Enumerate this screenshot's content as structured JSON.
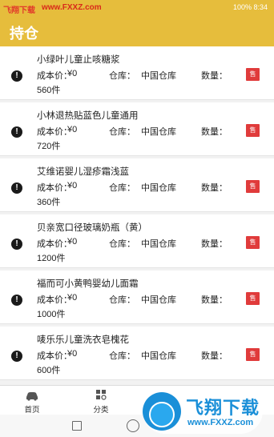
{
  "status_bar": {
    "left_watermark_a": "飞翔下载",
    "left_watermark_b": "www.FXXZ.com",
    "right_text": "100% 8:34"
  },
  "header": {
    "title": "持仓"
  },
  "labels": {
    "cost": "成本价：",
    "warehouse": "仓库：",
    "quantity": "数量：",
    "sell": "售"
  },
  "items": [
    {
      "name": "小绿叶儿童止咳糖浆",
      "cost": "¥0",
      "warehouse": "中国仓库",
      "qty": "560件"
    },
    {
      "name": "小林退热贴蓝色儿童通用",
      "cost": "¥0",
      "warehouse": "中国仓库",
      "qty": "720件"
    },
    {
      "name": "艾维诺婴儿湿疹霜浅蓝",
      "cost": "¥0",
      "warehouse": "中国仓库",
      "qty": "360件"
    },
    {
      "name": "贝亲宽口径玻璃奶瓶（黄）",
      "cost": "¥0",
      "warehouse": "中国仓库",
      "qty": "1200件"
    },
    {
      "name": "福而可小黄鸭婴幼儿面霜",
      "cost": "¥0",
      "warehouse": "中国仓库",
      "qty": "1000件"
    },
    {
      "name": "唛乐乐儿童洗衣皂槐花",
      "cost": "¥0",
      "warehouse": "中国仓库",
      "qty": "600件"
    }
  ],
  "tabbar": {
    "home": "首页",
    "category": "分类"
  },
  "watermark": {
    "title": "飞翔下载",
    "url": "www.FXXZ.com"
  },
  "colors": {
    "accent": "#e6bd3c",
    "sell": "#e03b3b"
  }
}
